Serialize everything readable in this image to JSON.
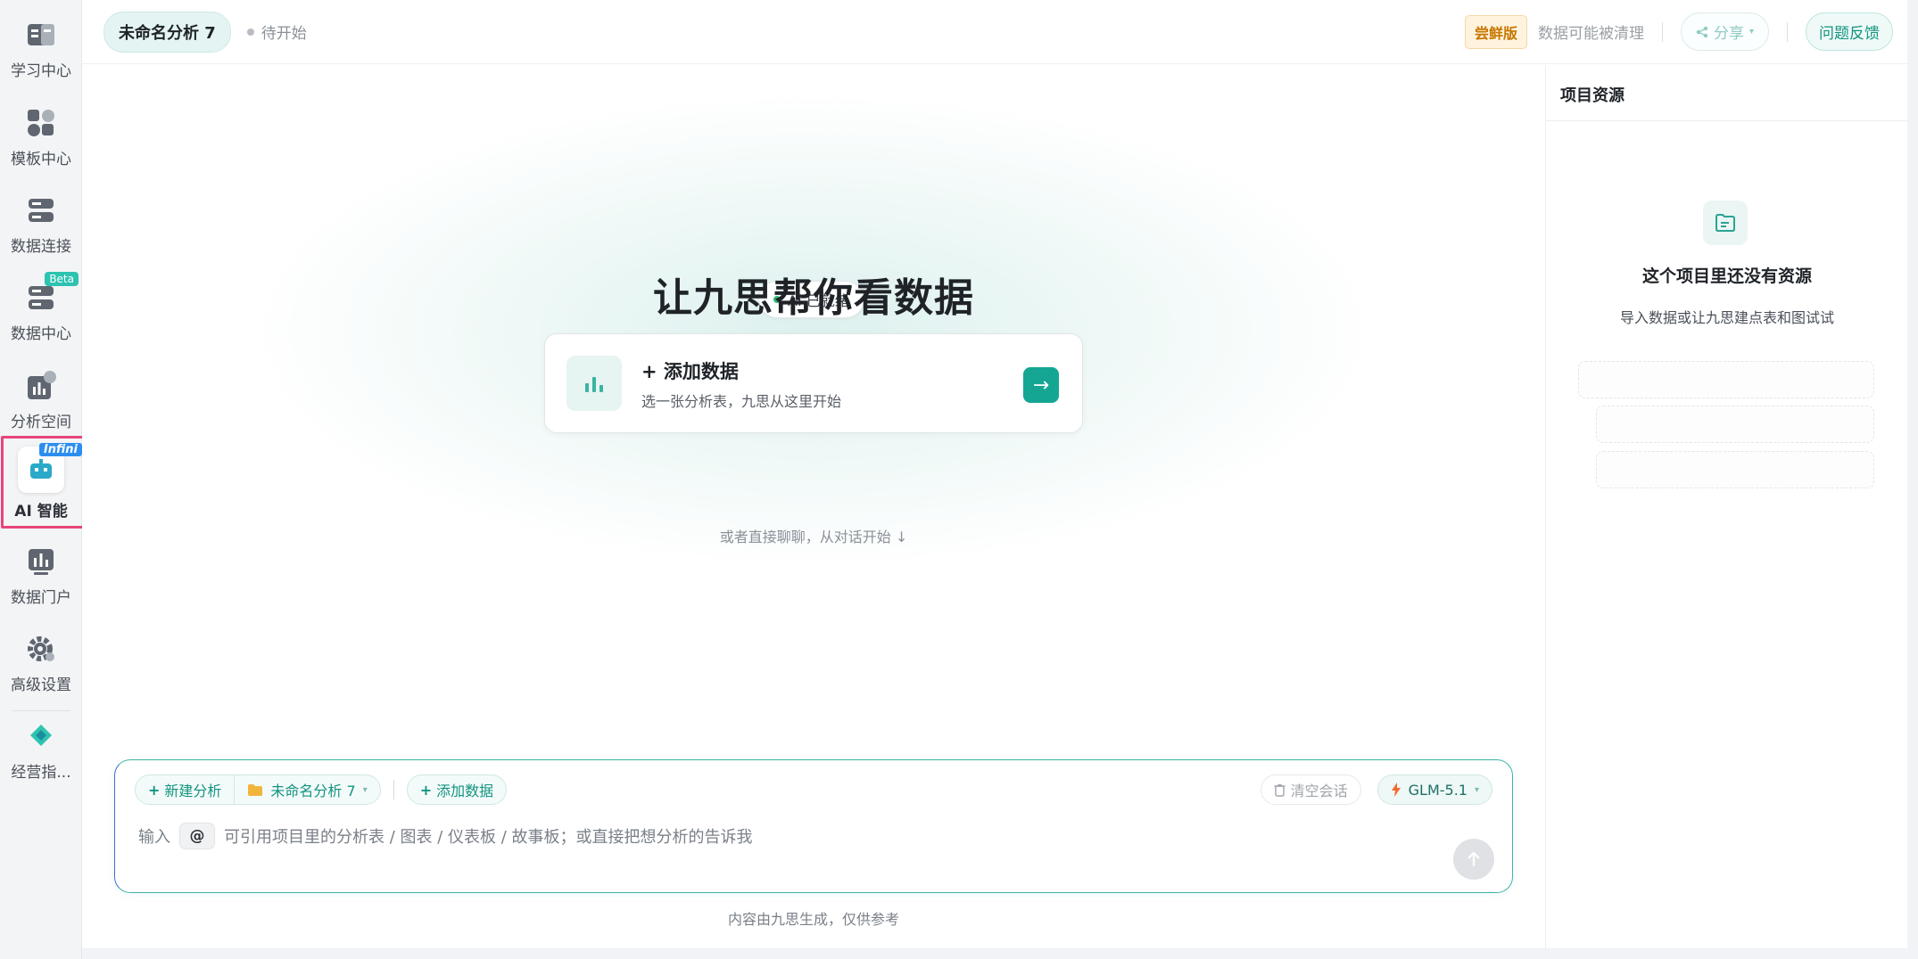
{
  "sidebar": {
    "items": [
      {
        "label": "学习中心",
        "icon": "book-icon"
      },
      {
        "label": "模板中心",
        "icon": "shapes-icon"
      },
      {
        "label": "数据连接",
        "icon": "database-link-icon"
      },
      {
        "label": "数据中心",
        "icon": "server-icon",
        "badge": "Beta"
      },
      {
        "label": "分析空间",
        "icon": "analysis-chart-icon"
      },
      {
        "label": "AI 智能",
        "icon": "robot-icon",
        "badge": "Infini",
        "active": true
      },
      {
        "label": "数据门户",
        "icon": "portal-chart-icon"
      },
      {
        "label": "高级设置",
        "icon": "gear-icon"
      },
      {
        "label": "经营指...",
        "icon": "diamond-logo-icon"
      }
    ]
  },
  "topbar": {
    "project_name": "未命名分析 7",
    "status": "待开始",
    "trial_badge": "尝鲜版",
    "trial_note": "数据可能被清理",
    "share_label": "分享",
    "feedback_label": "问题反馈"
  },
  "hero": {
    "ai_status": "AI 已就绪",
    "title": "让九思帮你看数据",
    "add_card_title": "+ 添加数据",
    "add_card_sub": "选一张分析表，九思从这里开始",
    "add_card_go": "→",
    "or_chat": "或者直接聊聊，从对话开始 ↓"
  },
  "composer": {
    "new_analysis": "新建分析",
    "project_select": "未命名分析 7",
    "add_data": "添加数据",
    "clear": "清空会话",
    "model": "GLM-5.1",
    "placeholder_prefix": "输入",
    "at": "@",
    "placeholder_suffix": "可引用项目里的分析表 / 图表 / 仪表板 / 故事板；或直接把想分析的告诉我",
    "disclaimer": "内容由九思生成，仅供参考"
  },
  "resources": {
    "header": "项目资源",
    "empty_title": "这个项目里还没有资源",
    "empty_sub": "导入数据或让九思建点表和图试试"
  },
  "colors": {
    "accent": "#14a693",
    "highlight_box": "#e8457a",
    "trial": "#c77700"
  }
}
